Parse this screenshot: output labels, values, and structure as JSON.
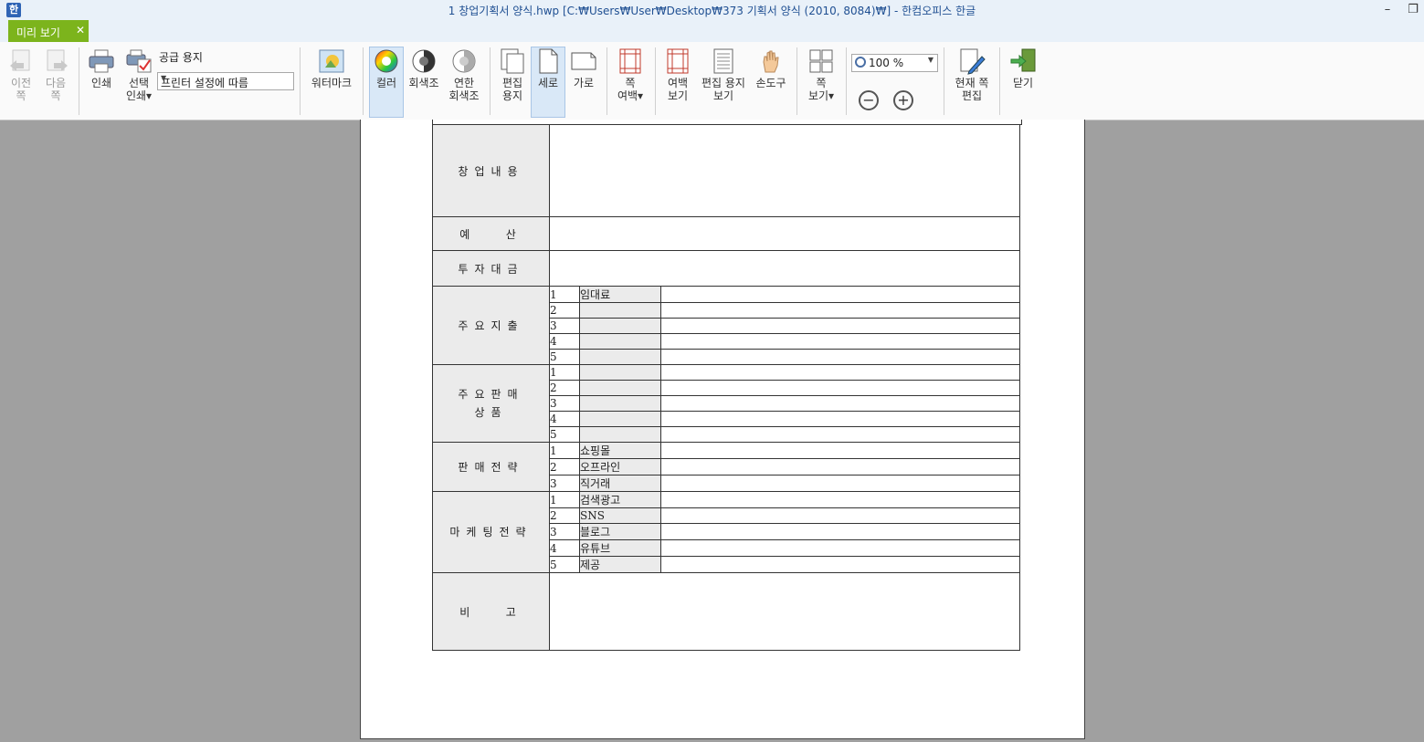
{
  "window": {
    "title": "1 창업기획서 양식.hwp [C:₩Users₩User₩Desktop₩373 기획서 양식 (2010, 8084)₩] - 한컴오피스 한글",
    "minimize": "–",
    "restore": "❐"
  },
  "tab": {
    "label": "미리 보기",
    "close": "✕"
  },
  "toolbar": {
    "prev": "이전\n쪽",
    "next": "다음\n쪽",
    "print": "인쇄",
    "select_print": "선택\n인쇄▾",
    "paper_label": "공급 용지",
    "paper_value": "프린터 설정에 따름",
    "watermark": "워터마크",
    "color": "컬러",
    "grayscale": "회색조",
    "light_grayscale": "연한\n회색조",
    "edit_paper": "편집\n용지",
    "portrait": "세로",
    "landscape": "가로",
    "page_margin": "쪽\n여백▾",
    "margin_view": "여백\n보기",
    "edit_paper_view": "편집 용지\n보기",
    "hand_tool": "손도구",
    "page_view": "쪽\n보기▾",
    "zoom_value": "100 %",
    "zoom_out": "−",
    "zoom_in": "+",
    "edit_current": "현재 쪽\n편집",
    "close": "닫기"
  },
  "form": {
    "startup_content": "창업내용",
    "budget": "예   산",
    "investment": "투자대금",
    "main_expense": {
      "label": "주요지출",
      "rows": [
        [
          "1",
          "임대료"
        ],
        [
          "2",
          ""
        ],
        [
          "3",
          ""
        ],
        [
          "4",
          ""
        ],
        [
          "5",
          ""
        ]
      ]
    },
    "main_products": {
      "label": "주요판매\n상품",
      "rows": [
        [
          "1",
          ""
        ],
        [
          "2",
          ""
        ],
        [
          "3",
          ""
        ],
        [
          "4",
          ""
        ],
        [
          "5",
          ""
        ]
      ]
    },
    "sales_strategy": {
      "label": "판매전략",
      "rows": [
        [
          "1",
          "쇼핑몰"
        ],
        [
          "2",
          "오프라인"
        ],
        [
          "3",
          "직거래"
        ]
      ]
    },
    "marketing": {
      "label": "마케팅전략",
      "rows": [
        [
          "1",
          "검색광고"
        ],
        [
          "2",
          "SNS"
        ],
        [
          "3",
          "블로그"
        ],
        [
          "4",
          "유튜브"
        ],
        [
          "5",
          "제공"
        ]
      ]
    },
    "remarks": "비   고"
  },
  "colors": {
    "tab_green": "#7cb41c",
    "title_blue": "#1f4f92",
    "cell_gray": "#ebebeb",
    "workspace": "#a0a0a0"
  }
}
